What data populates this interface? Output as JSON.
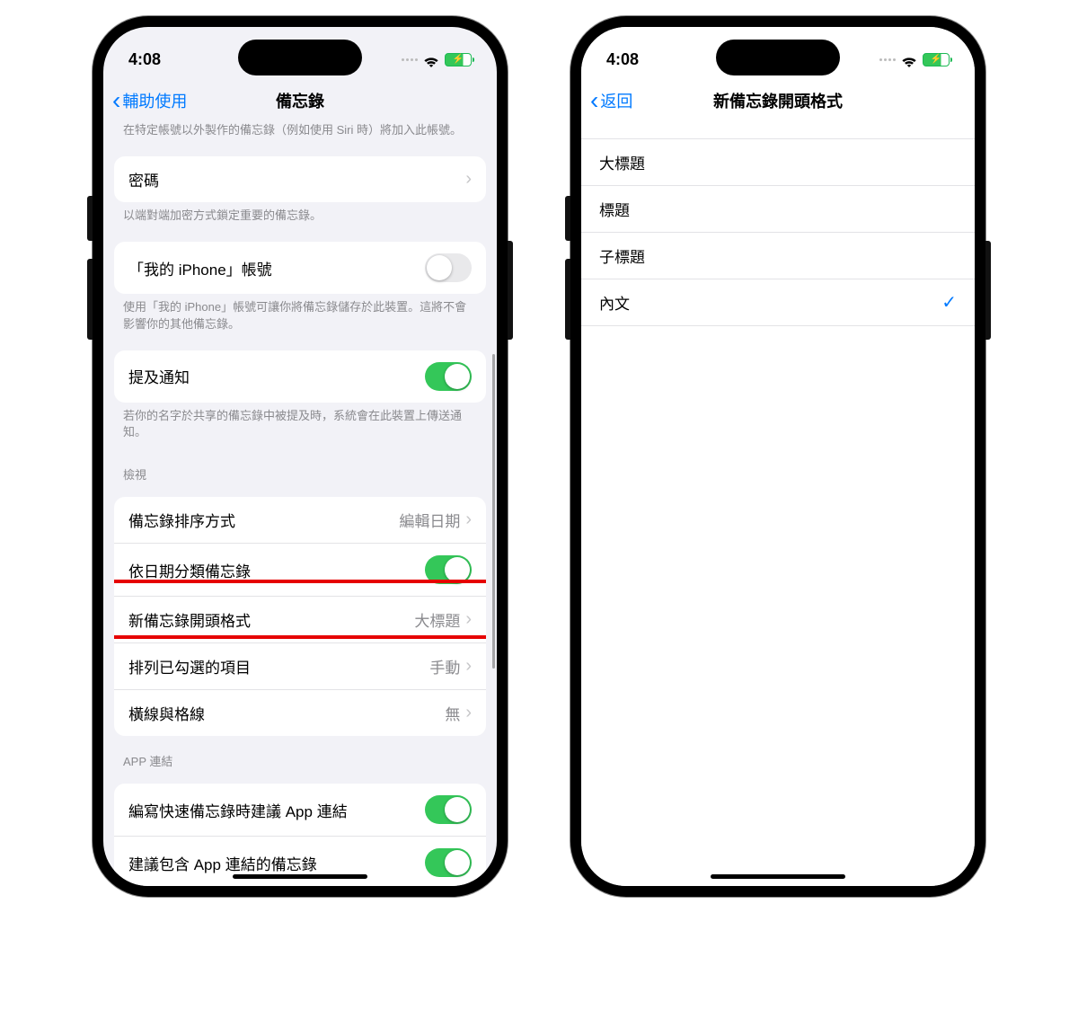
{
  "status": {
    "time": "4:08"
  },
  "phone1": {
    "nav": {
      "back": "輔助使用",
      "title": "備忘錄"
    },
    "cutFootnote": "在特定帳號以外製作的備忘錄（例如使用 Siri 時）將加入此帳號。",
    "password": {
      "label": "密碼"
    },
    "passwordFootnote": "以端對端加密方式鎖定重要的備忘錄。",
    "iphoneAccount": {
      "label": "「我的 iPhone」帳號",
      "on": false
    },
    "iphoneFootnote": "使用「我的 iPhone」帳號可讓你將備忘錄儲存於此裝置。這將不會影響你的其他備忘錄。",
    "mentionNotify": {
      "label": "提及通知",
      "on": true
    },
    "mentionFootnote": "若你的名字於共享的備忘錄中被提及時，系統會在此裝置上傳送通知。",
    "viewHeader": "檢視",
    "sortNotes": {
      "label": "備忘錄排序方式",
      "value": "編輯日期"
    },
    "groupByDate": {
      "label": "依日期分類備忘錄",
      "on": true
    },
    "newNoteFormat": {
      "label": "新備忘錄開頭格式",
      "value": "大標題"
    },
    "checkedItems": {
      "label": "排列已勾選的項目",
      "value": "手動"
    },
    "linesGrids": {
      "label": "橫線與格線",
      "value": "無"
    },
    "appLinkHeader": "APP 連結",
    "quickNoteLinks": {
      "label": "編寫快速備忘錄時建議 App 連結",
      "on": true
    },
    "suggestLinkedNotes": {
      "label": "建議包含 App 連結的備忘錄",
      "on": true
    }
  },
  "phone2": {
    "nav": {
      "back": "返回",
      "title": "新備忘錄開頭格式"
    },
    "options": {
      "title": "大標題",
      "heading": "標題",
      "subheading": "子標題",
      "body": "內文"
    },
    "selected": "body"
  }
}
